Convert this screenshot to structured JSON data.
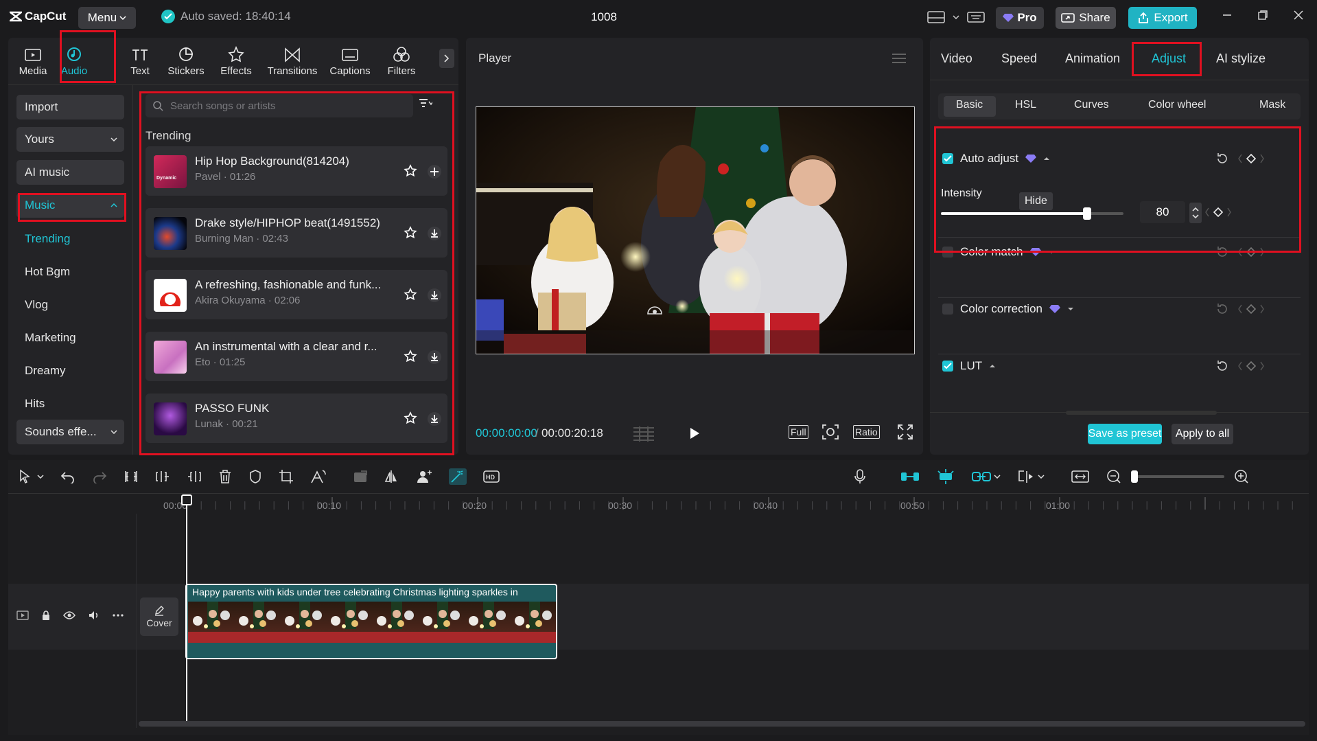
{
  "app": {
    "logo_text": "CapCut",
    "menu_label": "Menu",
    "autosave_text": "Auto saved: 18:40:14",
    "project_title": "1008",
    "pro_label": "Pro",
    "share_label": "Share",
    "export_label": "Export"
  },
  "media_tabs": [
    {
      "label": "Media",
      "icon": "media-icon"
    },
    {
      "label": "Audio",
      "icon": "audio-icon"
    },
    {
      "label": "Text",
      "icon": "text-icon"
    },
    {
      "label": "Stickers",
      "icon": "stickers-icon"
    },
    {
      "label": "Effects",
      "icon": "effects-icon"
    },
    {
      "label": "Transitions",
      "icon": "transitions-icon"
    },
    {
      "label": "Captions",
      "icon": "captions-icon"
    },
    {
      "label": "Filters",
      "icon": "filters-icon"
    }
  ],
  "sidebar": {
    "import": "Import",
    "yours": "Yours",
    "ai_music": "AI music",
    "music": "Music",
    "items": [
      "Trending",
      "Hot Bgm",
      "Vlog",
      "Marketing",
      "Dreamy",
      "Hits"
    ],
    "sounds_effects": "Sounds effe..."
  },
  "songs_panel": {
    "search_placeholder": "Search songs or artists",
    "section_label": "Trending",
    "songs": [
      {
        "title": "Hip Hop Background(814204)",
        "meta": "Pavel · 01:26",
        "thumb_text": "Dynamic",
        "action": "add"
      },
      {
        "title": "Drake style/HIPHOP beat(1491552)",
        "meta": "Burning Man · 02:43",
        "action": "download"
      },
      {
        "title": "A refreshing, fashionable and funk...",
        "meta": "Akira Okuyama · 02:06",
        "action": "download"
      },
      {
        "title": "An instrumental with a clear and r...",
        "meta": "Eto · 01:25",
        "action": "download"
      },
      {
        "title": "PASSO FUNK",
        "meta": "Lunak · 00:21",
        "action": "download"
      }
    ]
  },
  "player": {
    "title": "Player",
    "timecode_current": "00:00:00:00",
    "timecode_total": "00:00:20:18",
    "full_label": "Full",
    "ratio_label": "Ratio"
  },
  "inspector": {
    "tabs": [
      "Video",
      "Speed",
      "Animation",
      "Adjust",
      "AI stylize"
    ],
    "active_tab": "Adjust",
    "subtabs": [
      "Basic",
      "HSL",
      "Curves",
      "Color wheel",
      "Mask"
    ],
    "auto_adjust": {
      "label": "Auto adjust",
      "checked": true
    },
    "intensity": {
      "label": "Intensity",
      "value": "80",
      "fraction": 0.8,
      "tooltip": "Hide"
    },
    "color_match": {
      "label": "Color match",
      "checked": false
    },
    "color_correction": {
      "label": "Color correction",
      "checked": false
    },
    "lut": {
      "label": "LUT",
      "checked": true
    },
    "save_preset_label": "Save as preset",
    "apply_all_label": "Apply to all"
  },
  "timeline": {
    "ruler": [
      "00:00",
      "00:10",
      "00:20",
      "00:30",
      "00:40",
      "00:50",
      "01:00"
    ],
    "clip_label": "Happy parents with kids under tree celebrating Christmas lighting sparkles in",
    "cover_label": "Cover"
  },
  "colors": {
    "accent": "#20c5d5",
    "highlight": "#e01020",
    "panel": "#232326"
  }
}
